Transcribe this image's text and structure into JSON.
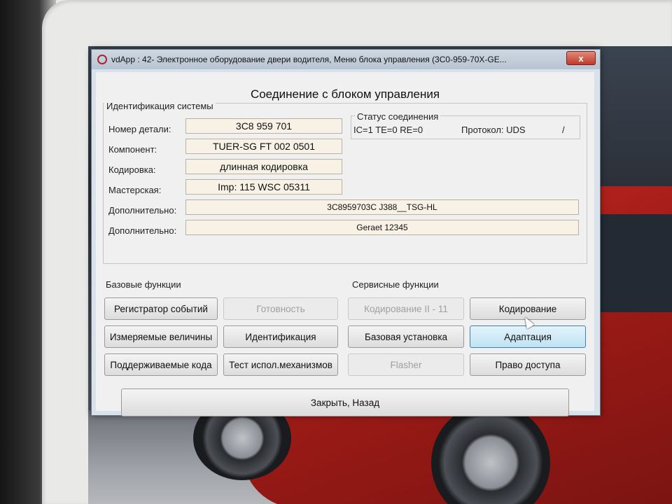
{
  "window": {
    "title": "vdApp : 42- Электронное оборудование двери водителя,  Меню блока управления (3C0-959-70X-GE...",
    "close_label": "x"
  },
  "heading": "Соединение с блоком управления",
  "identification": {
    "group_label": "Идентификация системы",
    "fields": [
      {
        "label": "Номер детали:",
        "value": "3C8 959 701"
      },
      {
        "label": "Компонент:",
        "value": "TUER-SG FT    002 0501"
      },
      {
        "label": "Кодировка:",
        "value": "длинная кодировка"
      },
      {
        "label": "Мастерская:",
        "value": "Imp: 115     WSC 05311"
      },
      {
        "label": "Дополнительно:",
        "value": "3C8959703C J388__TSG-HL"
      },
      {
        "label": "Дополнительно:",
        "value": "Geraet 12345"
      }
    ]
  },
  "connection_status": {
    "group_label": "Статус соединения",
    "line1": "IC=1  TE=0   RE=0",
    "protocol": "Протокол: UDS",
    "slash": "/"
  },
  "basic_functions": {
    "label": "Базовые функции",
    "buttons": [
      {
        "label": "Регистратор событий",
        "enabled": true
      },
      {
        "label": "Готовность",
        "enabled": false
      },
      {
        "label": "Измеряемые величины",
        "enabled": true
      },
      {
        "label": "Идентификация",
        "enabled": true
      },
      {
        "label": "Поддерживаемые кода",
        "enabled": true
      },
      {
        "label": "Тест испол.механизмов",
        "enabled": true
      }
    ]
  },
  "service_functions": {
    "label": "Сервисные функции",
    "buttons": [
      {
        "label": "Кодирование II - 11",
        "enabled": false
      },
      {
        "label": "Кодирование",
        "enabled": true
      },
      {
        "label": "Базовая установка",
        "enabled": true
      },
      {
        "label": "Адаптация",
        "enabled": true
      },
      {
        "label": "Flasher",
        "enabled": false
      },
      {
        "label": "Право доступа",
        "enabled": true
      }
    ]
  },
  "close_button": "Закрыть, Назад"
}
